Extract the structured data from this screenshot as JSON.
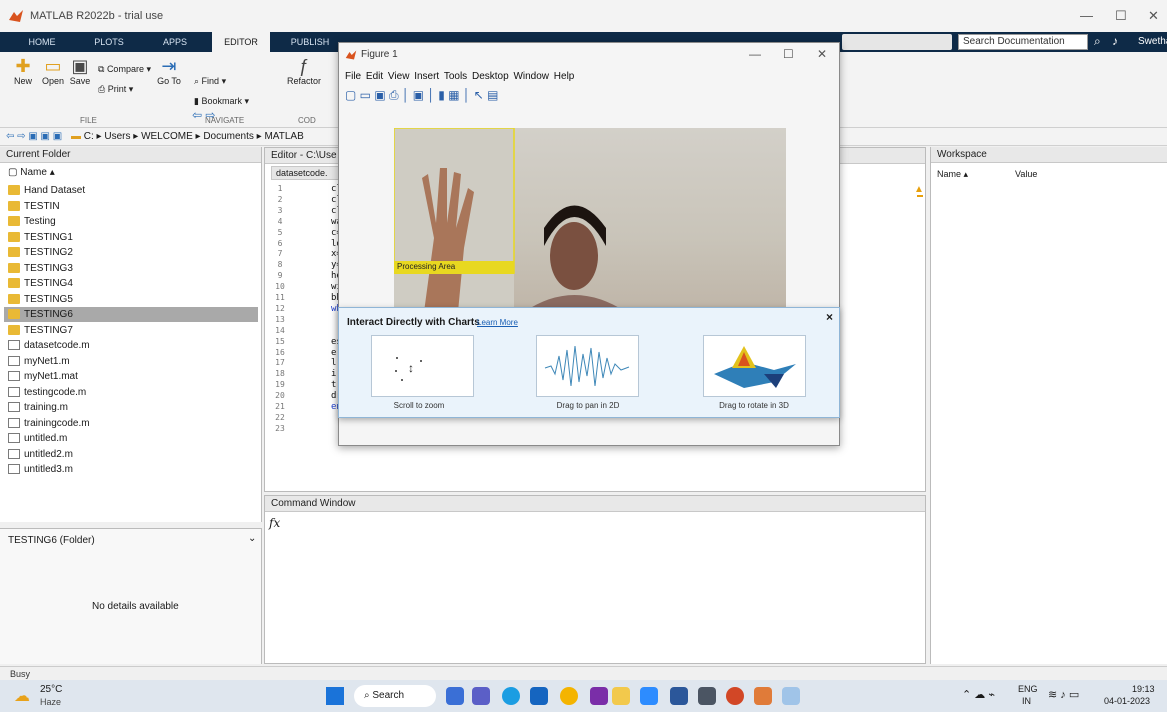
{
  "window": {
    "title": "MATLAB R2022b - trial use"
  },
  "ribbon": {
    "tabs": [
      "HOME",
      "PLOTS",
      "APPS",
      "EDITOR",
      "PUBLISH"
    ],
    "buttons": {
      "new": "New",
      "open": "Open",
      "save": "Save",
      "compare": "Compare",
      "print": "Print",
      "goto": "Go To",
      "find": "Find",
      "bookmark": "Bookmark",
      "refactor": "Refactor"
    },
    "groups": {
      "file": "FILE",
      "navigate": "NAVIGATE",
      "code": "COD"
    },
    "search_placeholder": "Search Documentation",
    "user": "Swetha"
  },
  "address": {
    "path": [
      "C:",
      "Users",
      "WELCOME",
      "Documents",
      "MATLAB"
    ]
  },
  "current_folder": {
    "title": "Current Folder",
    "column": "Name",
    "items": [
      {
        "name": "Hand Dataset",
        "type": "folder"
      },
      {
        "name": "TESTIN",
        "type": "folder"
      },
      {
        "name": "Testing",
        "type": "folder"
      },
      {
        "name": "TESTING1",
        "type": "folder"
      },
      {
        "name": "TESTING2",
        "type": "folder"
      },
      {
        "name": "TESTING3",
        "type": "folder"
      },
      {
        "name": "TESTING4",
        "type": "folder"
      },
      {
        "name": "TESTING5",
        "type": "folder"
      },
      {
        "name": "TESTING6",
        "type": "folder",
        "selected": true
      },
      {
        "name": "TESTING7",
        "type": "folder"
      },
      {
        "name": "datasetcode.m",
        "type": "file"
      },
      {
        "name": "myNet1.m",
        "type": "file"
      },
      {
        "name": "myNet1.mat",
        "type": "file"
      },
      {
        "name": "testingcode.m",
        "type": "file"
      },
      {
        "name": "training.m",
        "type": "file"
      },
      {
        "name": "trainingcode.m",
        "type": "file"
      },
      {
        "name": "untitled.m",
        "type": "file"
      },
      {
        "name": "untitled2.m",
        "type": "file"
      },
      {
        "name": "untitled3.m",
        "type": "file"
      }
    ],
    "details_title": "TESTING6 (Folder)",
    "details_text": "No details available"
  },
  "editor": {
    "title": "Editor - C:\\Use",
    "tab": "datasetcode.",
    "lines": [
      "1",
      "2",
      "3",
      "4",
      "5",
      "6",
      "7",
      "8",
      "9",
      "10",
      "11",
      "12",
      "13",
      "14",
      "15",
      "16",
      "17",
      "18",
      "19",
      "20",
      "21",
      "22",
      "23"
    ],
    "code": [
      "cl",
      "cl",
      "cl",
      "wa",
      "c=",
      "lo",
      "x=",
      "y=",
      "he",
      "wi",
      "bb",
      "wh",
      "",
      "",
      "es",
      "e",
      "l",
      "i",
      "t",
      "drawnow;",
      "end",
      "",
      ""
    ]
  },
  "command_window": {
    "title": "Command Window",
    "prompt": "fx"
  },
  "workspace": {
    "title": "Workspace",
    "col_name": "Name",
    "col_value": "Value"
  },
  "status": {
    "text": "Busy"
  },
  "figure": {
    "title": "Figure 1",
    "menus": [
      "File",
      "Edit",
      "View",
      "Insert",
      "Tools",
      "Desktop",
      "Window",
      "Help"
    ],
    "roi_label": "Processing Area"
  },
  "popup": {
    "title": "Interact Directly with Charts",
    "link": "Learn More",
    "close": "×",
    "items": [
      "Scroll to zoom",
      "Drag to pan in 2D",
      "Drag to rotate in 3D"
    ]
  },
  "taskbar": {
    "weather_temp": "25°C",
    "weather_desc": "Haze",
    "search": "Search",
    "lang1": "ENG",
    "lang2": "IN",
    "time": "19:13",
    "date": "04-01-2023"
  }
}
